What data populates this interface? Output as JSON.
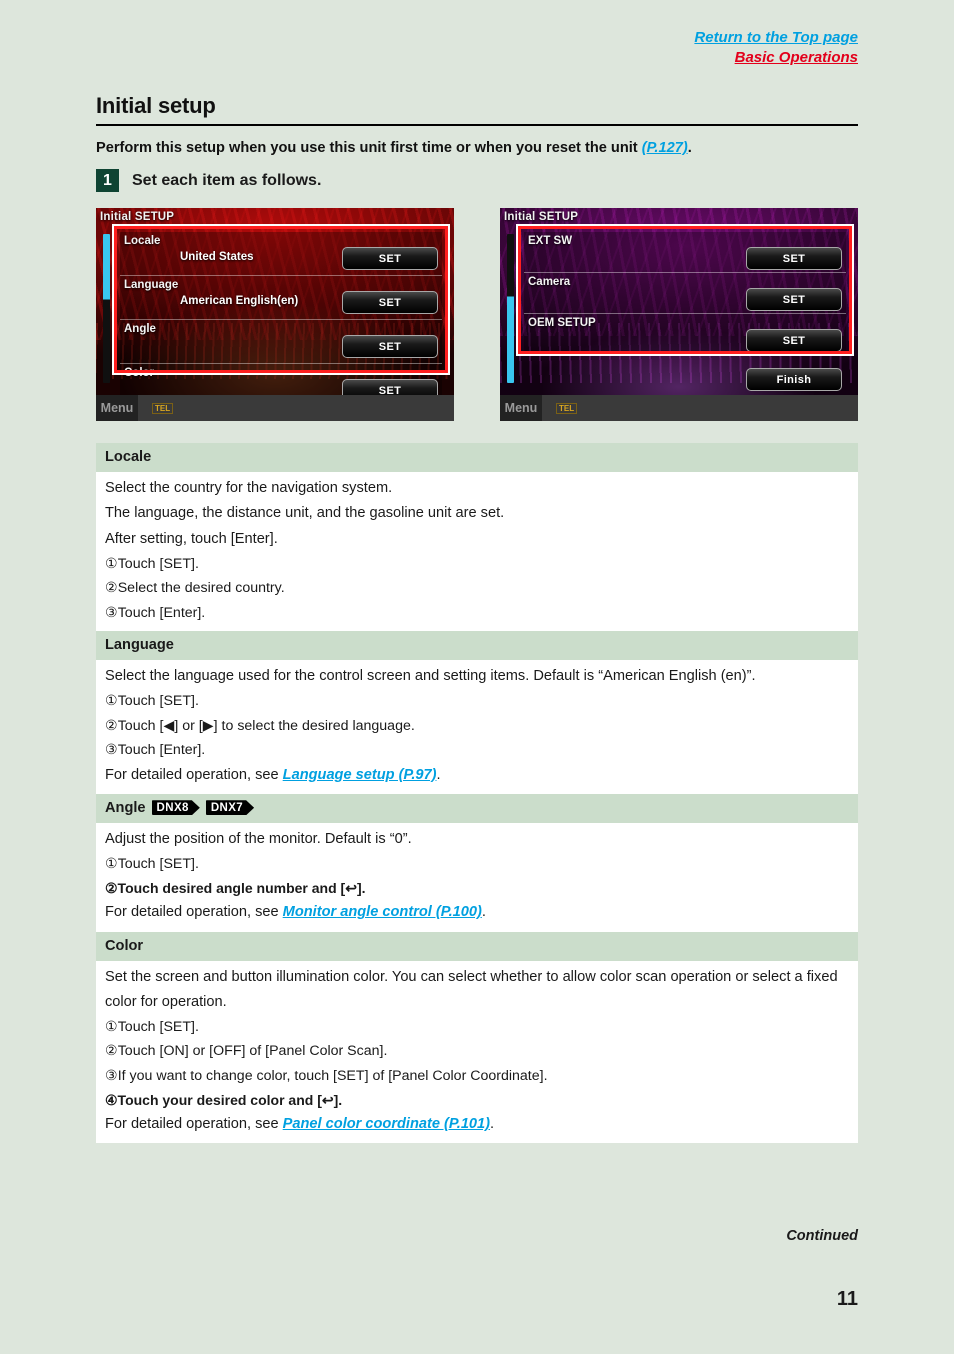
{
  "header": {
    "return_link": "Return to the Top page",
    "section_link": "Basic Operations"
  },
  "title": "Initial setup",
  "intro": {
    "text_before": "Perform this setup when you use this unit first time or when you reset the unit ",
    "ref": "(P.127)",
    "text_after": "."
  },
  "step": {
    "number": "1",
    "text": "Set each item as follows."
  },
  "screenshots": {
    "left": {
      "title": "Initial SETUP",
      "rows": [
        {
          "label": "Locale",
          "value": "United States",
          "button": "SET"
        },
        {
          "label": "Language",
          "value": "American English(en)",
          "button": "SET"
        },
        {
          "label": "Angle",
          "value": "",
          "button": "SET"
        },
        {
          "label": "Color",
          "value": "",
          "button": "SET"
        }
      ],
      "taskbar_menu": "Menu",
      "taskbar_tel": "TEL"
    },
    "right": {
      "title": "Initial SETUP",
      "rows": [
        {
          "label": "EXT SW",
          "value": "",
          "button": "SET"
        },
        {
          "label": "Camera",
          "value": "",
          "button": "SET"
        },
        {
          "label": "OEM SETUP",
          "value": "",
          "button": "SET"
        }
      ],
      "finish_button": "Finish",
      "taskbar_menu": "Menu",
      "taskbar_tel": "TEL"
    }
  },
  "sections": [
    {
      "heading": "Locale",
      "badges": [],
      "lines": [
        "Select the country for the navigation system.",
        "The language, the distance unit, and the gasoline unit are set.",
        "After setting, touch [Enter].",
        "①Touch [SET].",
        "②Select the desired country.",
        "③Touch [Enter]."
      ],
      "ref_line": null
    },
    {
      "heading": "Language",
      "badges": [],
      "lines": [
        "Select the language used for the control screen and setting items. Default is “American English (en)”.",
        "①Touch [SET].",
        "②Touch [◀] or [▶] to select the desired language.",
        "③Touch [Enter]."
      ],
      "ref_line": {
        "prefix": "For detailed operation, see ",
        "ref": "Language setup (P.97)",
        "suffix": "."
      }
    },
    {
      "heading": "Angle",
      "badges": [
        "DNX8",
        "DNX7"
      ],
      "lines": [
        "Adjust the position of the monitor. Default is “0”.",
        "①Touch [SET].",
        "②Touch desired angle number and [↩]."
      ],
      "ref_line": {
        "prefix": "For detailed operation, see ",
        "ref": "Monitor angle control (P.100)",
        "suffix": "."
      }
    },
    {
      "heading": "Color",
      "badges": [],
      "lines": [
        "Set the screen and button illumination color. You can select whether to allow color scan operation or select a fixed color for operation.",
        "①Touch [SET].",
        "②Touch [ON] or [OFF] of [Panel Color Scan].",
        "③If you want to change color, touch [SET] of [Panel Color Coordinate].",
        "④Touch your desired color and [↩]."
      ],
      "ref_line": {
        "prefix": "For detailed operation, see ",
        "ref": "Panel color coordinate (P.101)",
        "suffix": "."
      }
    }
  ],
  "footer": {
    "continued": "Continued",
    "page_number": "11"
  },
  "colors": {
    "page_bg": "#dde6dc",
    "table_header_bg": "#cbddcb",
    "link_blue": "#00a0e0",
    "link_red": "#e3001b",
    "step_badge_green": "#0f4433"
  }
}
